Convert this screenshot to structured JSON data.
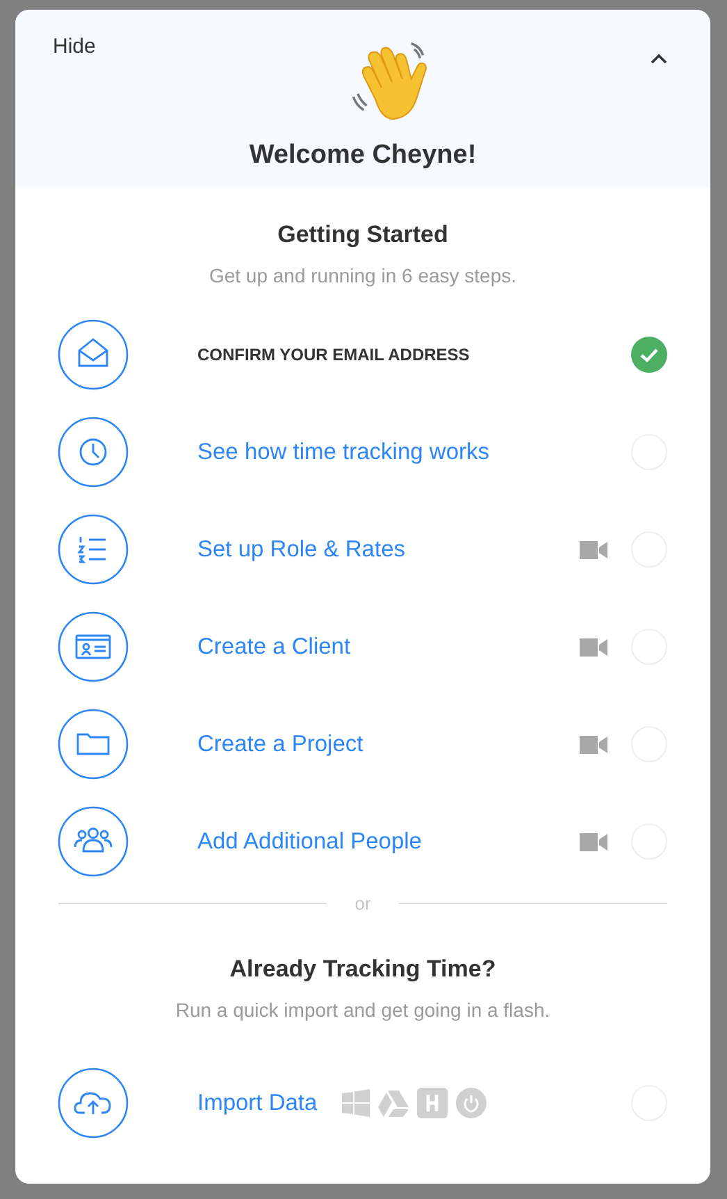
{
  "header": {
    "hide_label": "Hide",
    "collapsed": false,
    "title": "Welcome Cheyne!"
  },
  "getting_started": {
    "title": "Getting Started",
    "subtitle": "Get up and running in 6 easy steps.",
    "steps": [
      {
        "label": "CONFIRM YOUR EMAIL ADDRESS",
        "done": true,
        "video": false
      },
      {
        "label": "See how time tracking works",
        "done": false,
        "video": false
      },
      {
        "label": "Set up Role & Rates",
        "done": false,
        "video": true
      },
      {
        "label": "Create a Client",
        "done": false,
        "video": true
      },
      {
        "label": "Create a Project",
        "done": false,
        "video": true
      },
      {
        "label": "Add Additional People",
        "done": false,
        "video": true
      }
    ]
  },
  "divider_label": "or",
  "import": {
    "title": "Already Tracking Time?",
    "subtitle": "Run a quick import and get going in a flash.",
    "label": "Import Data",
    "done": false
  }
}
